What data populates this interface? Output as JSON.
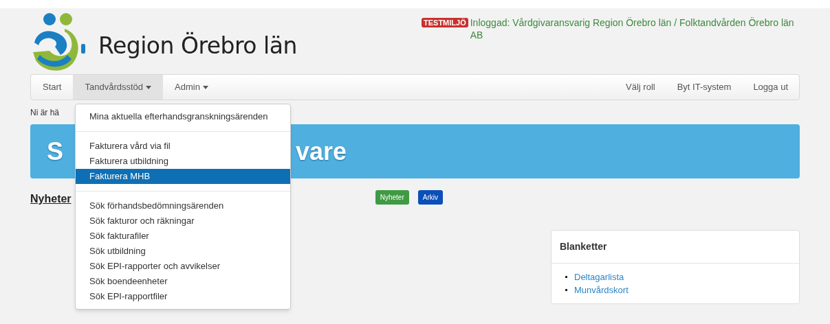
{
  "header": {
    "title": "Region Örebro län",
    "env_badge": "TESTMILJÖ",
    "login_text": "Inloggad: Vårdgivaransvarig Region Örebro län / Folktandvården Örebro län AB"
  },
  "nav": {
    "left": [
      {
        "label": "Start",
        "selected": false,
        "dropdown": false
      },
      {
        "label": "Tandvårdsstöd",
        "selected": true,
        "dropdown": true
      },
      {
        "label": "Admin",
        "selected": false,
        "dropdown": true
      }
    ],
    "right": [
      "Välj roll",
      "Byt IT-system",
      "Logga ut"
    ]
  },
  "breadcrumb": "Ni är hä",
  "banner": {
    "title_start": "S",
    "title_end": "vare"
  },
  "dropdown_menu": [
    {
      "kind": "item",
      "label": "Mina aktuella efterhandsgranskningsärenden",
      "selected": false
    },
    {
      "kind": "divider"
    },
    {
      "kind": "item",
      "label": "Fakturera vård via fil",
      "selected": false
    },
    {
      "kind": "item",
      "label": "Fakturera utbildning",
      "selected": false
    },
    {
      "kind": "item",
      "label": "Fakturera MHB",
      "selected": true
    },
    {
      "kind": "divider"
    },
    {
      "kind": "item",
      "label": "Sök förhandsbedömningsärenden",
      "selected": false
    },
    {
      "kind": "item",
      "label": "Sök fakturor och räkningar",
      "selected": false
    },
    {
      "kind": "item",
      "label": "Sök fakturafiler",
      "selected": false
    },
    {
      "kind": "item",
      "label": "Sök utbildning",
      "selected": false
    },
    {
      "kind": "item",
      "label": "Sök EPI-rapporter och avvikelser",
      "selected": false
    },
    {
      "kind": "item",
      "label": "Sök boendeenheter",
      "selected": false
    },
    {
      "kind": "item",
      "label": "Sök EPI-rapportfiler",
      "selected": false
    }
  ],
  "news": {
    "heading": "Nyheter",
    "buttons": [
      {
        "label": "Nyheter",
        "kind": "green"
      },
      {
        "label": "Arkiv",
        "kind": "blue"
      }
    ]
  },
  "forms_panel": {
    "title": "Blanketter",
    "links": [
      "Deltagarlista",
      "Munvårdskort"
    ]
  }
}
